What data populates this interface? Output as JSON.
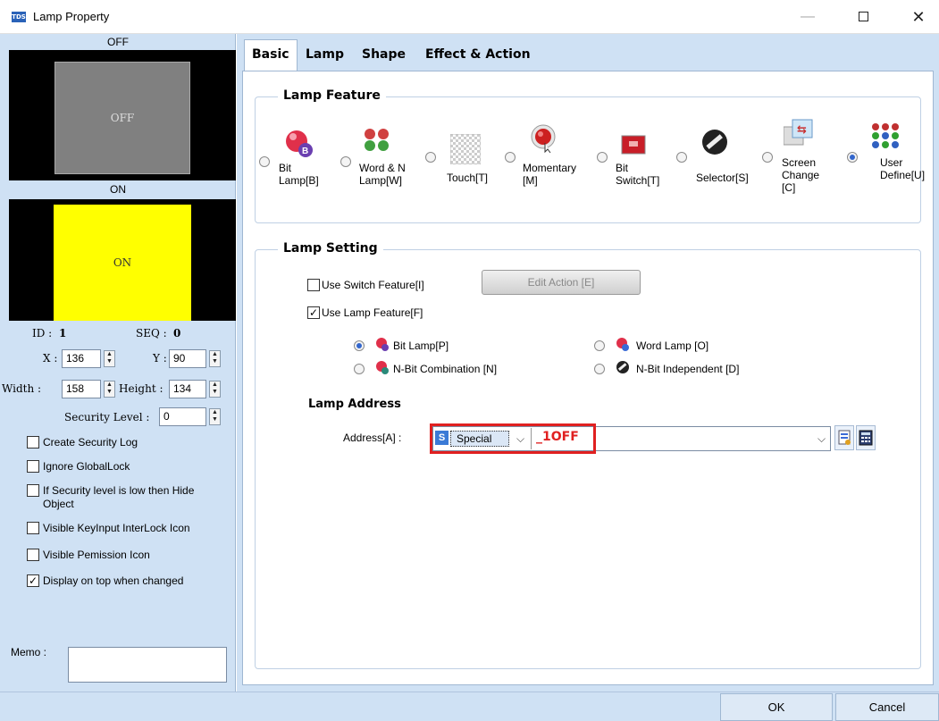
{
  "window": {
    "icon_text": "TDS",
    "title": "Lamp Property"
  },
  "left": {
    "off_label": "OFF",
    "off_swatch_text": "OFF",
    "on_label": "ON",
    "on_swatch_text": "ON",
    "id_label": "ID :",
    "id_value": "1",
    "seq_label": "SEQ :",
    "seq_value": "0",
    "x_label": "X :",
    "x_value": "136",
    "y_label": "Y :",
    "y_value": "90",
    "width_label": "Width :",
    "width_value": "158",
    "height_label": "Height :",
    "height_value": "134",
    "security_label": "Security Level :",
    "security_value": "0",
    "checkboxes": [
      {
        "label": "Create Security Log",
        "checked": false
      },
      {
        "label": "Ignore GlobalLock",
        "checked": false
      },
      {
        "label": "If Security level is low then Hide",
        "label2": "Object",
        "checked": false
      },
      {
        "label": "Visible KeyInput InterLock Icon",
        "checked": false
      },
      {
        "label": "Visible Pemission Icon",
        "checked": false
      },
      {
        "label": "Display on top when changed",
        "checked": true
      }
    ],
    "memo_label": "Memo :"
  },
  "tabs": [
    {
      "label": "Basic",
      "active": true
    },
    {
      "label": "Lamp"
    },
    {
      "label": "Shape"
    },
    {
      "label": "Effect & Action"
    }
  ],
  "lamp_feature": {
    "title": "Lamp Feature",
    "options": [
      {
        "line1": "Bit",
        "line2": "Lamp[B]",
        "icon": "bit-lamp-icon",
        "selected": false
      },
      {
        "line1": "Word & N",
        "line2": "Lamp[W]",
        "icon": "word-lamp-icon",
        "selected": false
      },
      {
        "line1": "Touch[T]",
        "line2": "",
        "icon": "touch-icon",
        "selected": false
      },
      {
        "line1": "Momentary",
        "line2": "[M]",
        "icon": "momentary-icon",
        "selected": false
      },
      {
        "line1": "Bit",
        "line2": "Switch[T]",
        "icon": "bit-switch-icon",
        "selected": false
      },
      {
        "line1": "Selector[S]",
        "line2": "",
        "icon": "selector-icon",
        "selected": false
      },
      {
        "line1": "Screen",
        "line2": "Change",
        "line3": "[C]",
        "icon": "screen-change-icon",
        "selected": false
      },
      {
        "line1": "User",
        "line2": "Define[U]",
        "icon": "user-define-icon",
        "selected": true
      }
    ]
  },
  "lamp_setting": {
    "title": "Lamp Setting",
    "use_switch_label": "Use Switch Feature[I]",
    "use_switch_checked": false,
    "edit_action_label": "Edit Action [E]",
    "use_lamp_label": "Use Lamp Feature[F]",
    "use_lamp_checked": true,
    "lamp_types": [
      {
        "label": "Bit Lamp[P]",
        "selected": true
      },
      {
        "label": "Word Lamp [O]",
        "selected": false
      },
      {
        "label": "N-Bit Combination [N]",
        "selected": false
      },
      {
        "label": "N-Bit Independent [D]",
        "selected": false
      }
    ],
    "address_title": "Lamp Address",
    "address_label": "Address[A] :",
    "device_badge": "S",
    "device_value": "Special",
    "address_value": "_1OFF"
  },
  "footer": {
    "ok_label": "OK",
    "cancel_label": "Cancel"
  },
  "colors": {
    "panel_bg": "#cfe1f4",
    "off_swatch": "#808080",
    "on_swatch": "#ffff00",
    "highlight": "#e02020"
  }
}
